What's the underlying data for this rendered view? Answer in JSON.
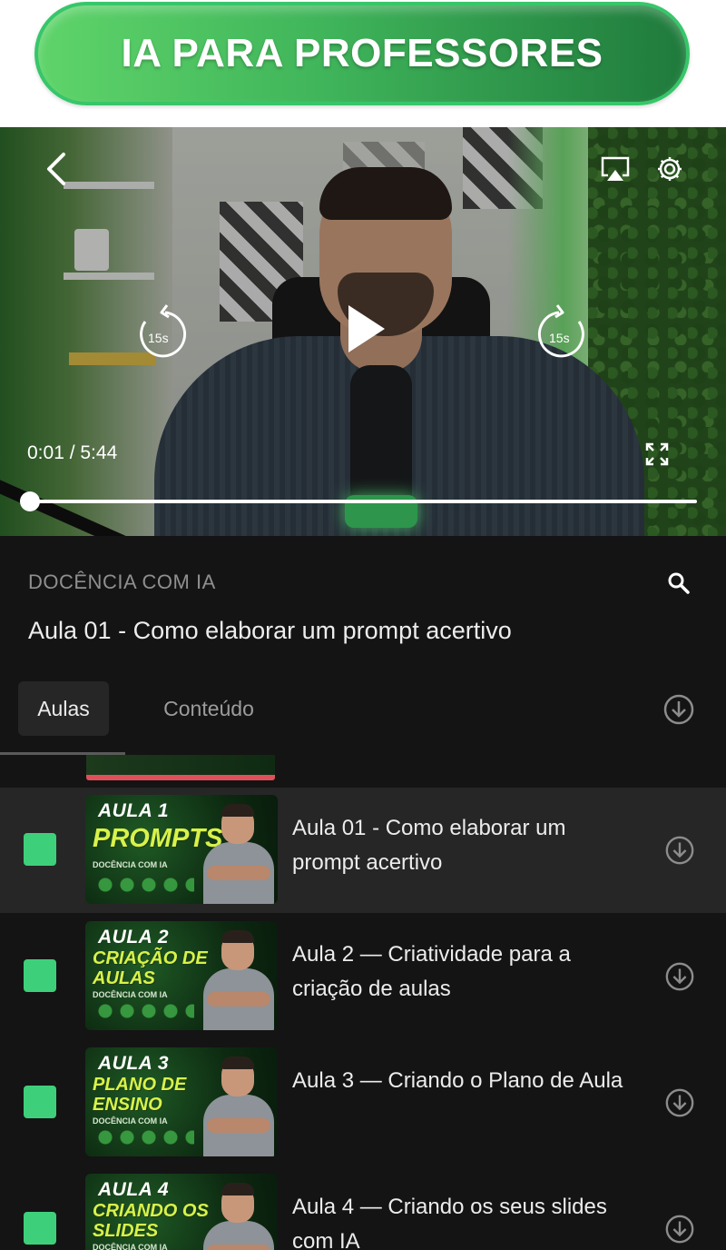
{
  "banner": {
    "title": "IA PARA PROFESSORES"
  },
  "player": {
    "time": "0:01 / 5:44",
    "rewind_label": "15s",
    "forward_label": "15s",
    "progress": 0.003,
    "icons": [
      "chevron-left-icon",
      "airplay-icon",
      "gear-icon",
      "rewind-15-icon",
      "play-icon",
      "forward-15-icon",
      "fullscreen-icon"
    ]
  },
  "course": {
    "module": "DOCÊNCIA COM IA",
    "current_lesson": "Aula 01 - Como elaborar um prompt acertivo"
  },
  "tabs": [
    {
      "label": "Aulas",
      "selected": true
    },
    {
      "label": "Conteúdo",
      "selected": false
    }
  ],
  "lessons": [
    {
      "title": "Aula 01 - Como elaborar um prompt acertivo",
      "thumb_aula": "AULA 1",
      "thumb_topic": "PROMPTS",
      "thumb_brand": "DOCÊNCIA COM IA",
      "active": true
    },
    {
      "title": "Aula 2 — Criatividade para a criação de aulas",
      "thumb_aula": "AULA 2",
      "thumb_topic": "CRIAÇÃO DE AULAS",
      "thumb_brand": "DOCÊNCIA COM IA",
      "active": false
    },
    {
      "title": "Aula 3 — Criando o Plano de Aula",
      "thumb_aula": "AULA 3",
      "thumb_topic": "PLANO DE ENSINO",
      "thumb_brand": "DOCÊNCIA COM IA",
      "active": false
    },
    {
      "title": "Aula 4 — Criando os seus slides com IA",
      "thumb_aula": "AULA 4",
      "thumb_topic": "CRIANDO OS SLIDES",
      "thumb_brand": "DOCÊNCIA COM IA",
      "active": false
    }
  ],
  "colors": {
    "accent": "#3ecf7a",
    "panel_bg": "#141414",
    "active_row_bg": "#262626",
    "banner_green": "#3fb45a"
  }
}
